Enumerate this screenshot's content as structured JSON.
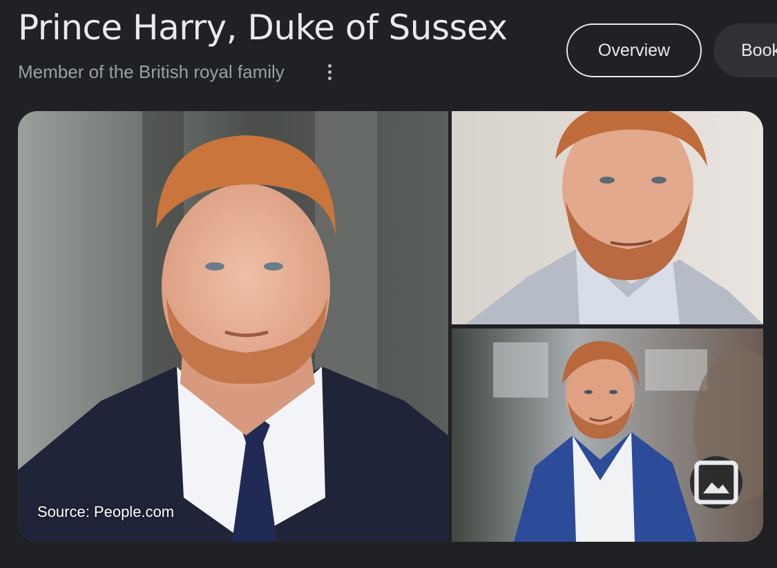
{
  "header": {
    "title": "Prince Harry, Duke of Sussex",
    "subtitle": "Member of the British royal family"
  },
  "tabs": [
    {
      "label": "Overview",
      "selected": true
    },
    {
      "label": "Books",
      "selected": false
    }
  ],
  "gallery": {
    "source_caption": "Source: People.com",
    "images": [
      {
        "icon": "portrait-photo"
      },
      {
        "icon": "portrait-photo"
      },
      {
        "icon": "portrait-photo"
      }
    ],
    "more_images_icon": "image-icon"
  },
  "colors": {
    "background": "#202124",
    "title_text": "#e8eaed",
    "subtitle_text": "#9aa0a6",
    "chip_border": "#e8eaed",
    "chip_fill": "#303134",
    "hair": "#c9753c",
    "suit_navy": "#1f2438",
    "suit_blue": "#2c4c9a",
    "suit_grey": "#b6bcc6"
  }
}
